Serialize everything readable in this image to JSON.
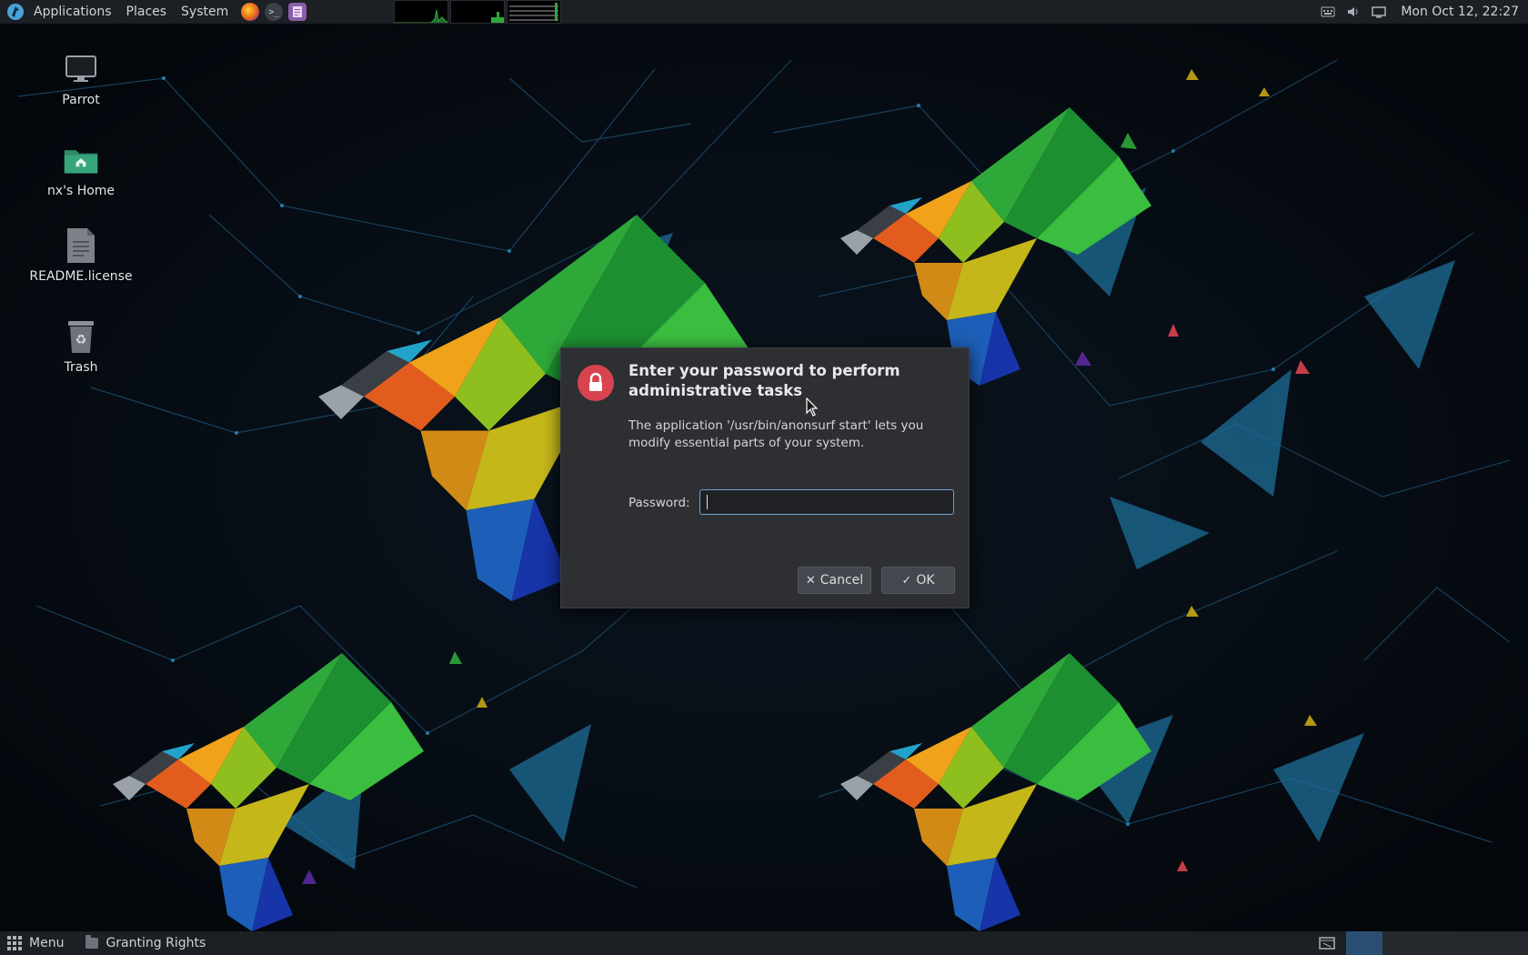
{
  "top_panel": {
    "menus": [
      "Applications",
      "Places",
      "System"
    ],
    "launchers": [
      "firefox-icon",
      "terminal-icon",
      "text-editor-icon"
    ],
    "clock": "Mon Oct 12, 22:27"
  },
  "desktop": {
    "icons": [
      {
        "label": "Parrot",
        "icon": "computer-icon"
      },
      {
        "label": "nx's Home",
        "icon": "home-folder-icon"
      },
      {
        "label": "README.license",
        "icon": "text-file-icon"
      },
      {
        "label": "Trash",
        "icon": "trash-icon"
      }
    ]
  },
  "dialog": {
    "title": "Enter your password to perform administrative tasks",
    "message": "The application '/usr/bin/anonsurf start' lets you modify essential parts of your system.",
    "password_label": "Password:",
    "password_value": "",
    "cancel_label": "Cancel",
    "ok_label": "OK",
    "accent": "#d9434f"
  },
  "bottom_panel": {
    "menu_label": "Menu",
    "tasks": [
      "Granting Rights"
    ]
  },
  "colors": {
    "panel": "#1c1f24",
    "dialog_bg": "#2d2f33",
    "input_focus": "#6fa2d8",
    "workspace_active": "#2b4f72"
  }
}
